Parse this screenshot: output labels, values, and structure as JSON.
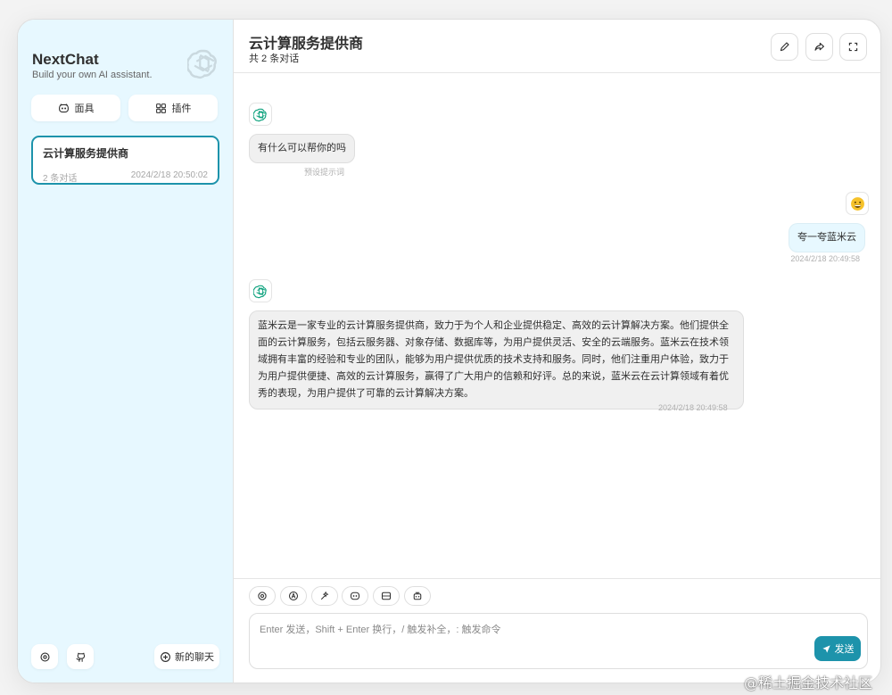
{
  "sidebar": {
    "brand_title": "NextChat",
    "brand_subtitle": "Build your own AI assistant.",
    "mask_button": "面具",
    "plugin_button": "插件",
    "chats": [
      {
        "title": "云计算服务提供商",
        "count": "2 条对话",
        "time": "2024/2/18 20:50:02"
      }
    ],
    "new_chat_button": "新的聊天"
  },
  "header": {
    "title": "云计算服务提供商",
    "subtitle": "共 2 条对话"
  },
  "messages": [
    {
      "role": "bot",
      "text": "有什么可以帮你的吗",
      "time": "预设提示词"
    },
    {
      "role": "user",
      "text": "夸一夸蓝米云",
      "time": "2024/2/18 20:49:58"
    },
    {
      "role": "bot",
      "text": "蓝米云是一家专业的云计算服务提供商，致力于为个人和企业提供稳定、高效的云计算解决方案。他们提供全面的云计算服务，包括云服务器、对象存储、数据库等，为用户提供灵活、安全的云端服务。蓝米云在技术领域拥有丰富的经验和专业的团队，能够为用户提供优质的技术支持和服务。同时，他们注重用户体验，致力于为用户提供便捷、高效的云计算服务，赢得了广大用户的信赖和好评。总的来说，蓝米云在云计算领域有着优秀的表现，为用户提供了可靠的云计算解决方案。",
      "time": "2024/2/18 20:49:58"
    }
  ],
  "input": {
    "placeholder": "Enter 发送，Shift + Enter 换行，/ 触发补全，: 触发命令",
    "value": "",
    "send_button": "发送"
  },
  "colors": {
    "accent": "#1d93ab",
    "sidebar_bg": "#e7f8ff",
    "bot_bubble": "#f0f0f0",
    "user_bubble": "#e7f8ff"
  },
  "icons": {
    "brand": "openai-logo-icon",
    "bot_avatar": "openai-logo-icon",
    "user_avatar": "smiley-emoji-icon",
    "toolbar": [
      "settings-icon",
      "theme-auto-icon",
      "prompt-icon",
      "mask-icon",
      "break-icon",
      "robot-icon"
    ]
  },
  "watermark": "@稀土掘金技术社区"
}
